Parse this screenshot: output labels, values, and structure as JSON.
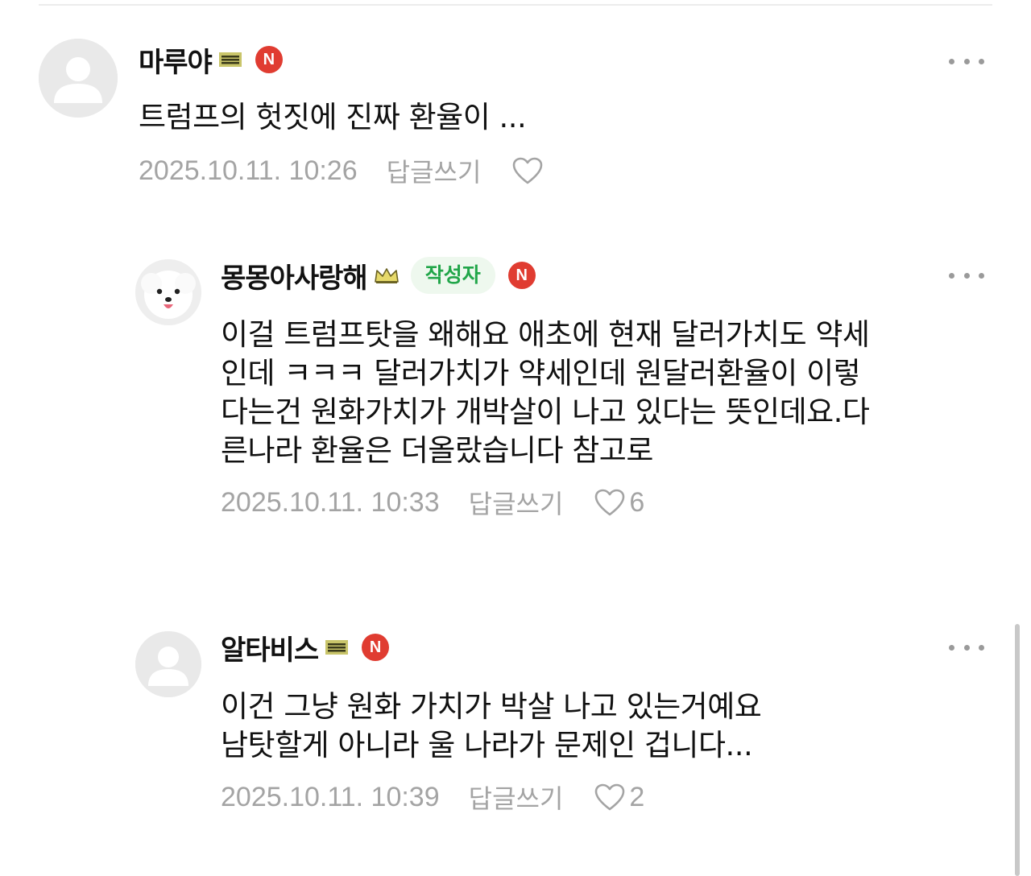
{
  "comments": [
    {
      "author": "마루야",
      "level_icon": "level-bars-icon",
      "badge_writer": "",
      "badge_n": "N",
      "text": "트럼프의 헛짓에 진짜 환율이 ...",
      "date": "2025.10.11. 10:26",
      "reply_label": "답글쓰기",
      "like_count": ""
    },
    {
      "author": "몽몽아사랑해",
      "level_icon": "level-crown-icon",
      "badge_writer": "작성자",
      "badge_n": "N",
      "text": "이걸 트럼프탓을 왜해요 애초에 현재 달러가치도 약세\n인데 ㅋㅋㅋ 달러가치가 약세인데 원달러환율이 이렇\n다는건 원화가치가 개박살이 나고 있다는 뜻인데요.다\n른나라 환율은 더올랐습니다 참고로",
      "date": "2025.10.11. 10:33",
      "reply_label": "답글쓰기",
      "like_count": "6"
    },
    {
      "author": "알타비스",
      "level_icon": "level-bars-icon",
      "badge_writer": "",
      "badge_n": "N",
      "text": "이건 그냥 원화 가치가 박살 나고 있는거예요\n남탓할게 아니라 울 나라가 문제인 겁니다...",
      "date": "2025.10.11. 10:39",
      "reply_label": "답글쓰기",
      "like_count": "2"
    }
  ],
  "colors": {
    "new_badge": "#e03c31",
    "writer_badge_bg": "#eef8ee",
    "writer_badge_text": "#22a64a",
    "meta_text": "#a4a4a4",
    "level_icon": "#c9c56a"
  },
  "icons": {
    "more": "more-dots-icon",
    "like": "heart-outline-icon",
    "default_avatar": "person-silhouette-icon",
    "dog_avatar": "dog-avatar-icon"
  }
}
